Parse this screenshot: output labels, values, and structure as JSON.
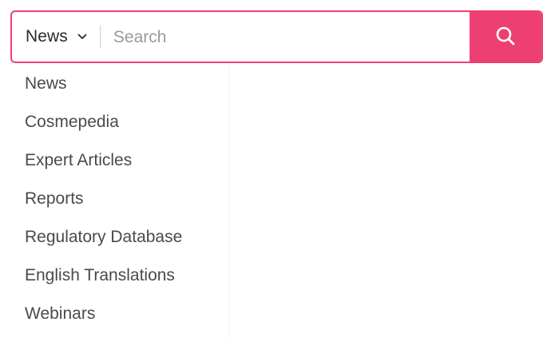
{
  "search": {
    "selected_category": "News",
    "placeholder": "Search",
    "value": ""
  },
  "dropdown": {
    "items": [
      {
        "label": "News"
      },
      {
        "label": "Cosmepedia"
      },
      {
        "label": "Expert Articles"
      },
      {
        "label": "Reports"
      },
      {
        "label": "Regulatory Database"
      },
      {
        "label": "English Translations"
      },
      {
        "label": "Webinars"
      }
    ]
  },
  "icons": {
    "chevron": "chevron-down-icon",
    "search": "search-icon"
  },
  "colors": {
    "accent": "#ee3f73",
    "text": "#4a4a4a",
    "placeholder": "#9a9a9a"
  }
}
